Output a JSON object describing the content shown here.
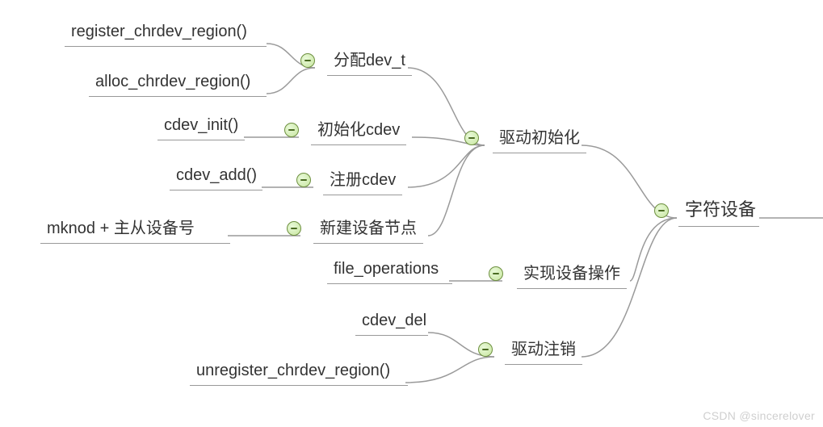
{
  "root": {
    "label": "字符设备"
  },
  "branches": {
    "driver_init": {
      "label": "驱动初始化",
      "children": {
        "alloc_devt": {
          "label": "分配dev_t",
          "children": {
            "register": "register_chrdev_region()",
            "alloc": "alloc_chrdev_region()"
          }
        },
        "init_cdev": {
          "label": "初始化cdev",
          "children": {
            "cdev_init": "cdev_init()"
          }
        },
        "reg_cdev": {
          "label": "注册cdev",
          "children": {
            "cdev_add": "cdev_add()"
          }
        },
        "mknod": {
          "label": "新建设备节点",
          "children": {
            "mknod_leaf": "mknod + 主从设备号"
          }
        }
      }
    },
    "dev_ops": {
      "label": "实现设备操作",
      "children": {
        "file_ops": "file_operations"
      }
    },
    "driver_exit": {
      "label": "驱动注销",
      "children": {
        "cdev_del": "cdev_del",
        "unregister": "unregister_chrdev_region()"
      }
    }
  },
  "watermark": "CSDN @sincerelover",
  "style": {
    "toggle_fill": "#cde8a6",
    "toggle_stroke": "#6d8f3f",
    "connector_stroke": "#9a9a9a"
  }
}
